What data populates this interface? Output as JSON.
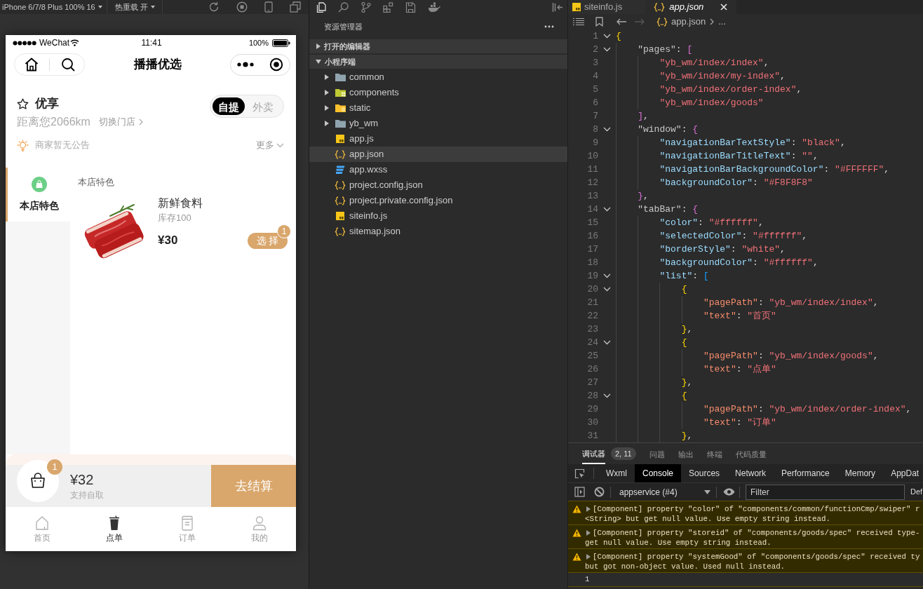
{
  "simulator": {
    "device": "iPhone 6/7/8 Plus 100% 16",
    "hot_reload": "热重载 开"
  },
  "phone": {
    "status_bar": {
      "carrier": "WeChat",
      "time": "11:41",
      "battery": "100%"
    },
    "nav_title": "播播优选",
    "store": {
      "name": "优享",
      "distance": "距离您2066km",
      "switch": "切换门店",
      "modes": [
        {
          "label": "自提",
          "selected": true
        },
        {
          "label": "外卖",
          "selected": false
        }
      ]
    },
    "notice": {
      "text": "商家暂无公告",
      "more": "更多"
    },
    "categories": [
      {
        "label": "本店特色",
        "selected": true
      }
    ],
    "section_title": "本店特色",
    "products": [
      {
        "name": "新鲜食料",
        "stock": "库存100",
        "price": "¥30",
        "action": "选 择",
        "count": "1"
      }
    ],
    "cart": {
      "count": "1",
      "total": "¥32",
      "note": "支持自取",
      "checkout": "去结算"
    },
    "tab_bar": [
      {
        "label": "首页",
        "selected": false
      },
      {
        "label": "点单",
        "selected": true
      },
      {
        "label": "订单",
        "selected": false
      },
      {
        "label": "我的",
        "selected": false
      }
    ]
  },
  "explorer": {
    "title": "资源管理器",
    "sections": [
      {
        "label": "打开的编辑器",
        "expanded": false
      },
      {
        "label": "小程序端",
        "expanded": true,
        "children": [
          {
            "name": "common",
            "kind": "folder",
            "expanded": false,
            "selected": false
          },
          {
            "name": "components",
            "kind": "modules",
            "expanded": false,
            "selected": false
          },
          {
            "name": "static",
            "kind": "assets",
            "expanded": false,
            "selected": false
          },
          {
            "name": "yb_wm",
            "kind": "folder",
            "expanded": false,
            "selected": false
          },
          {
            "name": "app.js",
            "kind": "js",
            "selected": false
          },
          {
            "name": "app.json",
            "kind": "json",
            "selected": true
          },
          {
            "name": "app.wxss",
            "kind": "wxss",
            "selected": false
          },
          {
            "name": "project.config.json",
            "kind": "json",
            "selected": false
          },
          {
            "name": "project.private.config.json",
            "kind": "json",
            "selected": false
          },
          {
            "name": "siteinfo.js",
            "kind": "js",
            "selected": false
          },
          {
            "name": "sitemap.json",
            "kind": "json",
            "selected": false
          }
        ]
      }
    ]
  },
  "editor": {
    "tabs": [
      {
        "label": "siteinfo.js",
        "kind": "js",
        "selected": false
      },
      {
        "label": "app.json",
        "kind": "json",
        "selected": true
      }
    ],
    "breadcrumb": {
      "file": "app.json",
      "more": "..."
    },
    "lines": [
      {
        "number": "1",
        "code": "{",
        "foldable": true
      },
      {
        "number": "2",
        "code": "    \"pages\": [",
        "foldable": true
      },
      {
        "number": "3",
        "code": "        \"yb_wm/index/index\","
      },
      {
        "number": "4",
        "code": "        \"yb_wm/index/my-index\","
      },
      {
        "number": "5",
        "code": "        \"yb_wm/index/order-index\","
      },
      {
        "number": "6",
        "code": "        \"yb_wm/index/goods\""
      },
      {
        "number": "7",
        "code": "    ],"
      },
      {
        "number": "8",
        "code": "    \"window\": {",
        "foldable": true
      },
      {
        "number": "9",
        "code": "        \"navigationBarTextStyle\": \"black\","
      },
      {
        "number": "10",
        "code": "        \"navigationBarTitleText\": \"\","
      },
      {
        "number": "11",
        "code": "        \"navigationBarBackgroundColor\": \"#FFFFFF\","
      },
      {
        "number": "12",
        "code": "        \"backgroundColor\": \"#F8F8F8\""
      },
      {
        "number": "13",
        "code": "    },"
      },
      {
        "number": "14",
        "code": "    \"tabBar\": {",
        "foldable": true
      },
      {
        "number": "15",
        "code": "        \"color\": \"#ffffff\","
      },
      {
        "number": "16",
        "code": "        \"selectedColor\": \"#ffffff\","
      },
      {
        "number": "17",
        "code": "        \"borderStyle\": \"white\","
      },
      {
        "number": "18",
        "code": "        \"backgroundColor\": \"#ffffff\","
      },
      {
        "number": "19",
        "code": "        \"list\": [",
        "foldable": true
      },
      {
        "number": "20",
        "code": "            {",
        "foldable": true
      },
      {
        "number": "21",
        "code": "                \"pagePath\": \"yb_wm/index/index\","
      },
      {
        "number": "22",
        "code": "                \"text\": \"首页\""
      },
      {
        "number": "23",
        "code": "            },"
      },
      {
        "number": "24",
        "code": "            {",
        "foldable": true
      },
      {
        "number": "25",
        "code": "                \"pagePath\": \"yb_wm/index/goods\","
      },
      {
        "number": "26",
        "code": "                \"text\": \"点单\""
      },
      {
        "number": "27",
        "code": "            },"
      },
      {
        "number": "28",
        "code": "            {",
        "foldable": true
      },
      {
        "number": "29",
        "code": "                \"pagePath\": \"yb_wm/index/order-index\","
      },
      {
        "number": "30",
        "code": "                \"text\": \"订单\""
      },
      {
        "number": "31",
        "code": "            },"
      }
    ]
  },
  "debugger": {
    "tabs": [
      {
        "label": "调试器",
        "badge": "2, 11",
        "selected": true
      },
      {
        "label": "问题",
        "selected": false
      },
      {
        "label": "输出",
        "selected": false
      },
      {
        "label": "终端",
        "selected": false
      },
      {
        "label": "代码质量",
        "selected": false
      }
    ],
    "devtools_tabs": [
      {
        "label": "Wxml",
        "selected": false
      },
      {
        "label": "Console",
        "selected": true
      },
      {
        "label": "Sources",
        "selected": false
      },
      {
        "label": "Network",
        "selected": false
      },
      {
        "label": "Performance",
        "selected": false
      },
      {
        "label": "Memory",
        "selected": false
      },
      {
        "label": "AppDat",
        "selected": false
      }
    ],
    "context": "appservice (#4)",
    "filter": {
      "placeholder": "Filter"
    },
    "dropdown": "Def",
    "messages": [
      {
        "kind": "warning",
        "lines": [
          "[Component] property \"color\" of \"components/common/functionCmp/swiper\" r",
          "<String> but get null value. Use empty string instead."
        ]
      },
      {
        "kind": "warning",
        "lines": [
          "[Component] property \"storeid\" of \"components/goods/spec\" received type-",
          "get null value. Use empty string instead."
        ]
      },
      {
        "kind": "warning",
        "lines": [
          "[Component] property \"systemGood\" of \"components/goods/spec\" received ty",
          "but got non-object value. Used null instead."
        ]
      },
      {
        "kind": "log",
        "lines": [
          "1"
        ]
      }
    ]
  }
}
